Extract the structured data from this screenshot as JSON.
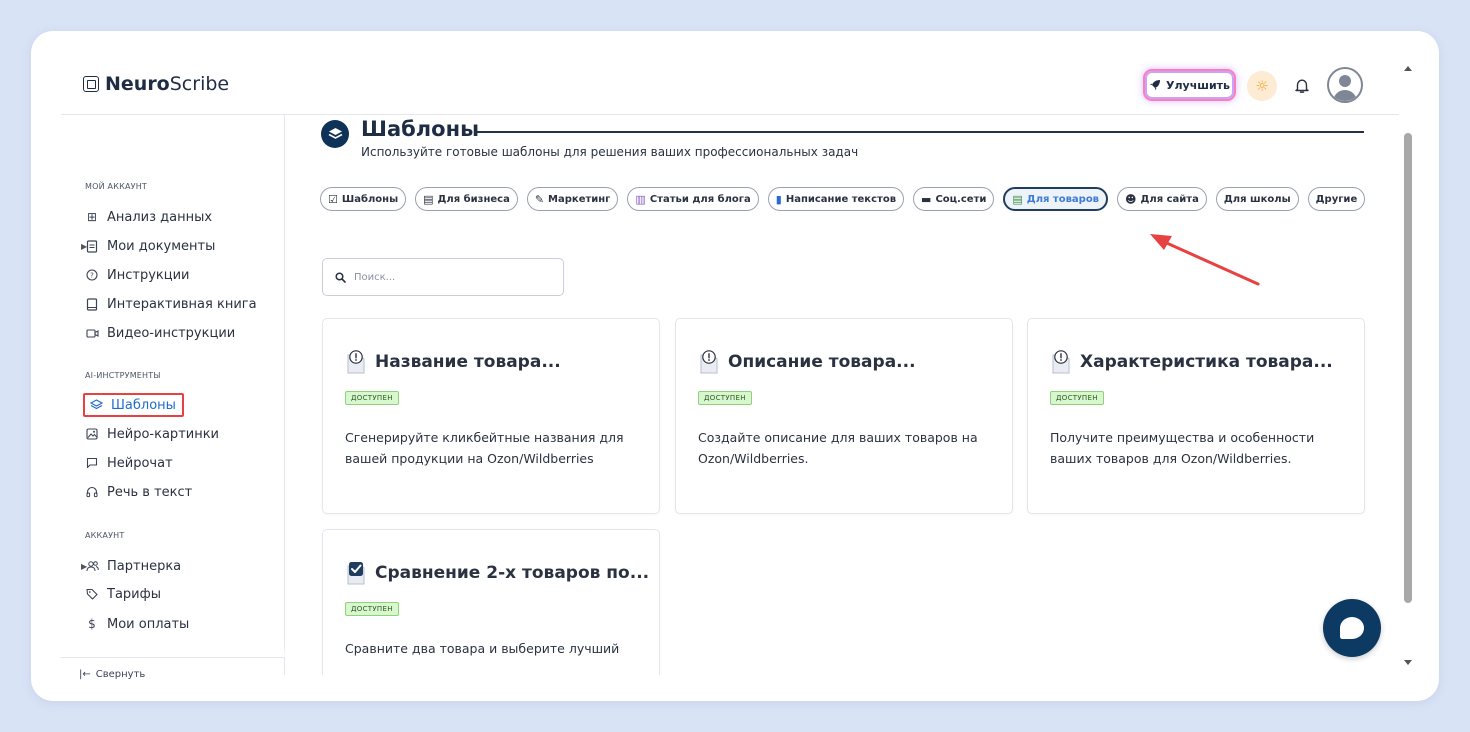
{
  "app": {
    "logo_bold": "Neuro",
    "logo_rest": "Scribe"
  },
  "header": {
    "upgrade_label": "Улучшить",
    "icons": [
      "rocket-icon",
      "sun-icon",
      "bell-icon",
      "avatar"
    ]
  },
  "sidebar": {
    "sections": [
      {
        "title": "МОЙ АККАУНТ"
      },
      {
        "title": "AI-ИНСТРУМЕНТЫ"
      },
      {
        "title": "АККАУНТ"
      }
    ],
    "items": [
      {
        "label": "Анализ данных",
        "icon": "grid-icon"
      },
      {
        "label": "Мои документы",
        "icon": "document-icon",
        "expandable": true
      },
      {
        "label": "Инструкции",
        "icon": "question-circle-icon"
      },
      {
        "label": "Интерактивная книга",
        "icon": "book-icon"
      },
      {
        "label": "Видео-инструкции",
        "icon": "video-icon"
      },
      {
        "label": "Шаблоны",
        "icon": "layers-icon",
        "active": true
      },
      {
        "label": "Нейро-картинки",
        "icon": "image-icon"
      },
      {
        "label": "Нейрочат",
        "icon": "chat-icon"
      },
      {
        "label": "Речь в текст",
        "icon": "headphones-icon"
      },
      {
        "label": "Партнерка",
        "icon": "users-icon",
        "expandable": true
      },
      {
        "label": "Тарифы",
        "icon": "tag-icon"
      },
      {
        "label": "Мои оплаты",
        "icon": "dollar-icon"
      }
    ],
    "collapse_label": "Свернуть"
  },
  "main": {
    "title": "Шаблоны",
    "subtitle": "Используйте готовые шаблоны для решения ваших профессиональных задач",
    "tabs": [
      {
        "label": "Шаблоны",
        "icon": "checkbox-icon"
      },
      {
        "label": "Для бизнеса",
        "icon": "calculator-icon"
      },
      {
        "label": "Маркетинг",
        "icon": "memo-icon"
      },
      {
        "label": "Статьи для блога",
        "icon": "books-icon"
      },
      {
        "label": "Написание текстов",
        "icon": "phone-icon"
      },
      {
        "label": "Соц.сети",
        "icon": "laptop-icon"
      },
      {
        "label": "Для товаров",
        "icon": "ledger-icon",
        "active": true
      },
      {
        "label": "Для сайта",
        "icon": "robot-icon"
      },
      {
        "label": "Для школы",
        "icon": ""
      },
      {
        "label": "Другие",
        "icon": ""
      }
    ],
    "search": {
      "placeholder": "Поиск..."
    },
    "cards": [
      {
        "title": "Название товара...",
        "badge": "ДОСТУПЕН",
        "description": "Сгенерируйте кликбейтные названия для вашей продукции на Ozon/Wildberries",
        "icon": "document-alert-icon"
      },
      {
        "title": "Описание товара...",
        "badge": "ДОСТУПЕН",
        "description": "Создайте описание для ваших товаров на Ozon/Wildberries.",
        "icon": "document-alert-icon"
      },
      {
        "title": "Характеристика товара...",
        "badge": "ДОСТУПЕН",
        "description": "Получите преимущества и особенности ваших товаров для Ozon/Wildberries.",
        "icon": "document-alert-icon"
      },
      {
        "title": "Сравнение 2-х товаров по...",
        "badge": "ДОСТУПЕН",
        "description": "Сравните два товара и выберите лучший",
        "icon": "check-box-icon"
      }
    ]
  },
  "colors": {
    "accent": "#1e6bd1",
    "navy": "#0f3258",
    "highlight_box": "#e84141",
    "annotation_arrow": "#e84141",
    "badge_bg": "#d8f7cf"
  }
}
